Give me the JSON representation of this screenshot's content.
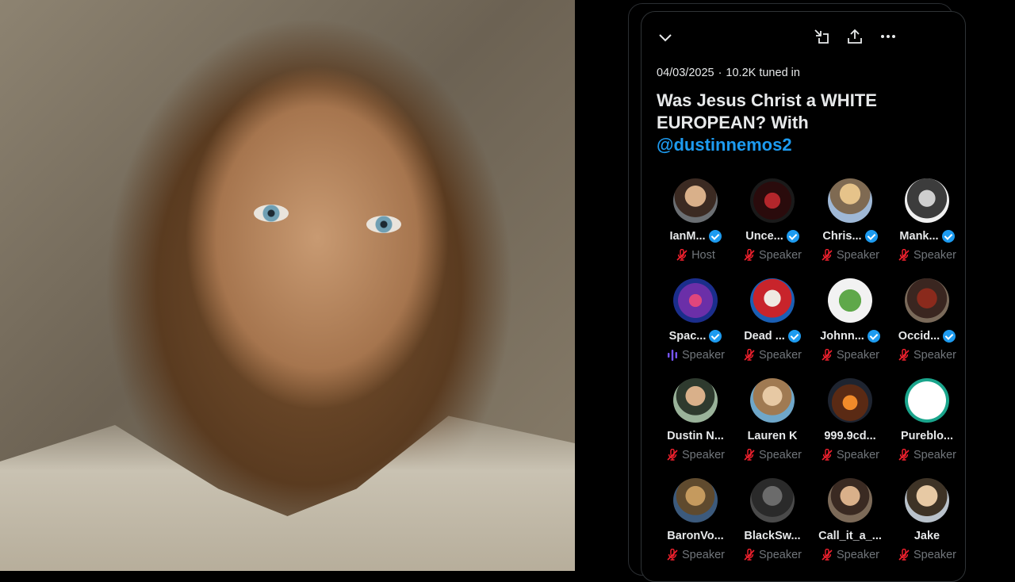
{
  "left_image": {
    "subject": "photo"
  },
  "space": {
    "date": "04/03/2025",
    "separator": "·",
    "tuned_in": "10.2K tuned in",
    "title_line1": "Was Jesus Christ a WHITE",
    "title_line2": "EUROPEAN? With",
    "mention": "@dustinnemos2"
  },
  "toolbar": {
    "collapse_icon": "chevron-down-icon",
    "minimize_icon": "minimize-icon",
    "share_icon": "share-icon",
    "more_icon": "more-icon"
  },
  "colors": {
    "accent": "#1d9bf0",
    "muted_mic": "#f4212e",
    "speaking": "#7856ff",
    "text": "#e7e9ea",
    "secondary": "#71767b"
  },
  "participants": [
    {
      "name": "IanM...",
      "role": "Host",
      "verified": true,
      "status": "muted"
    },
    {
      "name": "Unce...",
      "role": "Speaker",
      "verified": true,
      "status": "muted"
    },
    {
      "name": "Chris...",
      "role": "Speaker",
      "verified": true,
      "status": "muted"
    },
    {
      "name": "Mank...",
      "role": "Speaker",
      "verified": true,
      "status": "muted"
    },
    {
      "name": "Spac...",
      "role": "Speaker",
      "verified": true,
      "status": "speaking"
    },
    {
      "name": "Dead ...",
      "role": "Speaker",
      "verified": true,
      "status": "muted"
    },
    {
      "name": "Johnn...",
      "role": "Speaker",
      "verified": true,
      "status": "muted"
    },
    {
      "name": "Occid...",
      "role": "Speaker",
      "verified": true,
      "status": "muted"
    },
    {
      "name": "Dustin N...",
      "role": "Speaker",
      "verified": false,
      "status": "muted"
    },
    {
      "name": "Lauren K",
      "role": "Speaker",
      "verified": false,
      "status": "muted"
    },
    {
      "name": "999.9cd...",
      "role": "Speaker",
      "verified": false,
      "status": "muted"
    },
    {
      "name": "Pureblo...",
      "role": "Speaker",
      "verified": false,
      "status": "muted"
    },
    {
      "name": "BaronVo...",
      "role": "Speaker",
      "verified": false,
      "status": "muted"
    },
    {
      "name": "BlackSw...",
      "role": "Speaker",
      "verified": false,
      "status": "muted"
    },
    {
      "name": "Call_it_a_...",
      "role": "Speaker",
      "verified": false,
      "status": "muted"
    },
    {
      "name": "Jake",
      "role": "Speaker",
      "verified": false,
      "status": "muted"
    }
  ]
}
